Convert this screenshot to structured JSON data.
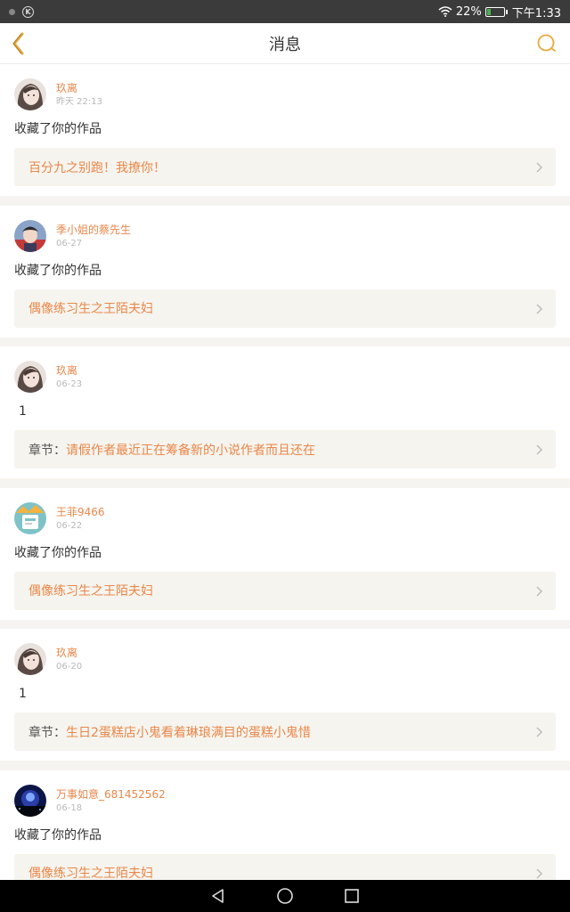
{
  "status_bar": {
    "battery_percent": "22%",
    "battery_level": 0.22,
    "time": "下午1:33",
    "icons": [
      "signal-dot-icon",
      "k-app-icon",
      "wifi-icon",
      "battery-icon"
    ]
  },
  "header": {
    "title": "消息",
    "back_icon": "chevron-left-icon",
    "search_icon": "search-icon",
    "accent": "#e8a83c"
  },
  "colors": {
    "name_accent": "#e9874a",
    "card_bg": "#f6f4ee",
    "separator": "#f6f4f1"
  },
  "messages": [
    {
      "user": "玖离",
      "time": "昨天 22:13",
      "action": "收藏了你的作品",
      "prefix": "",
      "target": "百分九之别跑！我撩你！",
      "avatar": "avatar-girl"
    },
    {
      "user": "季小姐的蔡先生",
      "time": "06-27",
      "action": "收藏了你的作品",
      "prefix": "",
      "target": "偶像练习生之王陌夫妇",
      "avatar": "avatar-boy"
    },
    {
      "user": "玖离",
      "time": "06-23",
      "action": "1",
      "prefix": "章节：",
      "target": "请假作者最近正在筹备新的小说作者而且还在",
      "avatar": "avatar-girl"
    },
    {
      "user": "王菲9466",
      "time": "06-22",
      "action": "收藏了你的作品",
      "prefix": "",
      "target": "偶像练习生之王陌夫妇",
      "avatar": "avatar-cartoon"
    },
    {
      "user": "玖离",
      "time": "06-20",
      "action": "1",
      "prefix": "章节：",
      "target": "生日2蛋糕店小鬼看着琳琅满目的蛋糕小鬼惜",
      "avatar": "avatar-girl"
    },
    {
      "user": "万事如意_681452562",
      "time": "06-18",
      "action": "收藏了你的作品",
      "prefix": "",
      "target": "偶像练习生之王陌夫妇",
      "avatar": "avatar-night"
    }
  ],
  "nav_bar": {
    "icons": [
      "back-triangle-icon",
      "home-circle-icon",
      "recents-square-icon"
    ]
  }
}
